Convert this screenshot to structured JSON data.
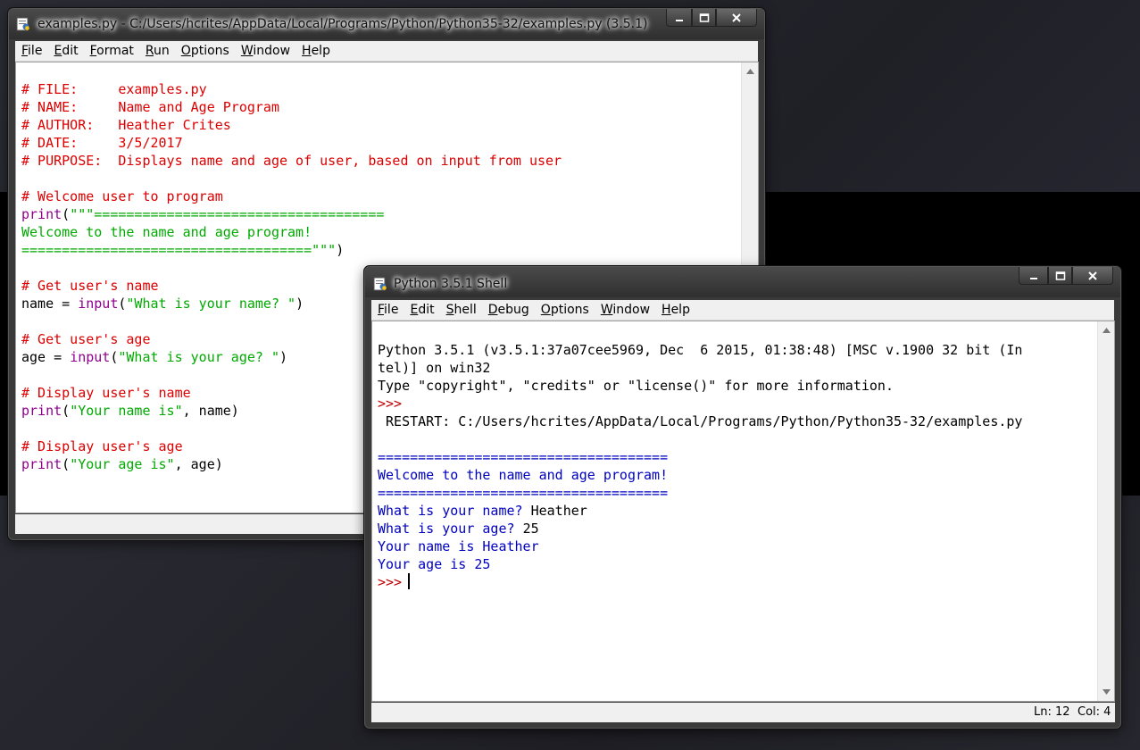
{
  "editor_window": {
    "title": "examples.py - C:/Users/hcrites/AppData/Local/Programs/Python/Python35-32/examples.py (3.5.1)",
    "menu": [
      {
        "label": "File",
        "key": "F",
        "rest": "ile"
      },
      {
        "label": "Edit",
        "key": "E",
        "rest": "dit"
      },
      {
        "label": "Format",
        "key": "F",
        "rest": "ormat"
      },
      {
        "label": "Run",
        "key": "R",
        "rest": "un"
      },
      {
        "label": "Options",
        "key": "O",
        "rest": "ptions"
      },
      {
        "label": "Window",
        "key": "W",
        "rest": "indow"
      },
      {
        "label": "Help",
        "key": "H",
        "rest": "elp"
      }
    ],
    "code": {
      "l1": "# FILE:     examples.py",
      "l2": "# NAME:     Name and Age Program",
      "l3": "# AUTHOR:   Heather Crites",
      "l4": "# DATE:     3/5/2017",
      "l5": "# PURPOSE:  Displays name and age of user, based on input from user",
      "l7": "# Welcome user to program",
      "l8_fn": "print",
      "l8_open": "(",
      "l8_str": "\"\"\"====================================",
      "l9": "Welcome to the name and age program!",
      "l10_str": "====================================\"\"\"",
      "l10_close": ")",
      "l12": "# Get user's name",
      "l13_pre": "name = ",
      "l13_fn": "input",
      "l13_open": "(",
      "l13_str": "\"What is your name? \"",
      "l13_close": ")",
      "l15": "# Get user's age",
      "l16_pre": "age = ",
      "l16_fn": "input",
      "l16_open": "(",
      "l16_str": "\"What is your age? \"",
      "l16_close": ")",
      "l18": "# Display user's name",
      "l19_fn": "print",
      "l19_open": "(",
      "l19_str": "\"Your name is\"",
      "l19_rest": ", name)",
      "l21": "# Display user's age",
      "l22_fn": "print",
      "l22_open": "(",
      "l22_str": "\"Your age is\"",
      "l22_rest": ", age)"
    }
  },
  "shell_window": {
    "title": "Python 3.5.1 Shell",
    "menu": [
      {
        "label": "File",
        "key": "F",
        "rest": "ile"
      },
      {
        "label": "Edit",
        "key": "E",
        "rest": "dit"
      },
      {
        "label": "Shell",
        "key": "S",
        "rest": "hell"
      },
      {
        "label": "Debug",
        "key": "D",
        "rest": "ebug"
      },
      {
        "label": "Options",
        "key": "O",
        "rest": "ptions"
      },
      {
        "label": "Window",
        "key": "W",
        "rest": "indow"
      },
      {
        "label": "Help",
        "key": "H",
        "rest": "elp"
      }
    ],
    "output": {
      "l1": "Python 3.5.1 (v3.5.1:37a07cee5969, Dec  6 2015, 01:38:48) [MSC v.1900 32 bit (In",
      "l2": "tel)] on win32",
      "l3": "Type \"copyright\", \"credits\" or \"license()\" for more information.",
      "l4": ">>> ",
      "l5": " RESTART: C:/Users/hcrites/AppData/Local/Programs/Python/Python35-32/examples.py",
      "l7": "====================================",
      "l8": "Welcome to the name and age program!",
      "l9": "====================================",
      "l10_prompt": "What is your name? ",
      "l10_input": "Heather",
      "l11_prompt": "What is your age? ",
      "l11_input": "25",
      "l12": "Your name is Heather",
      "l13": "Your age is 25",
      "l14": ">>> "
    },
    "status": {
      "line": "Ln: 12",
      "col": "Col: 4"
    }
  },
  "colors": {
    "comment": "#dd0000",
    "builtin": "#900090",
    "string": "#00aa00",
    "output": "#0000c0",
    "prompt": "#c00000"
  }
}
